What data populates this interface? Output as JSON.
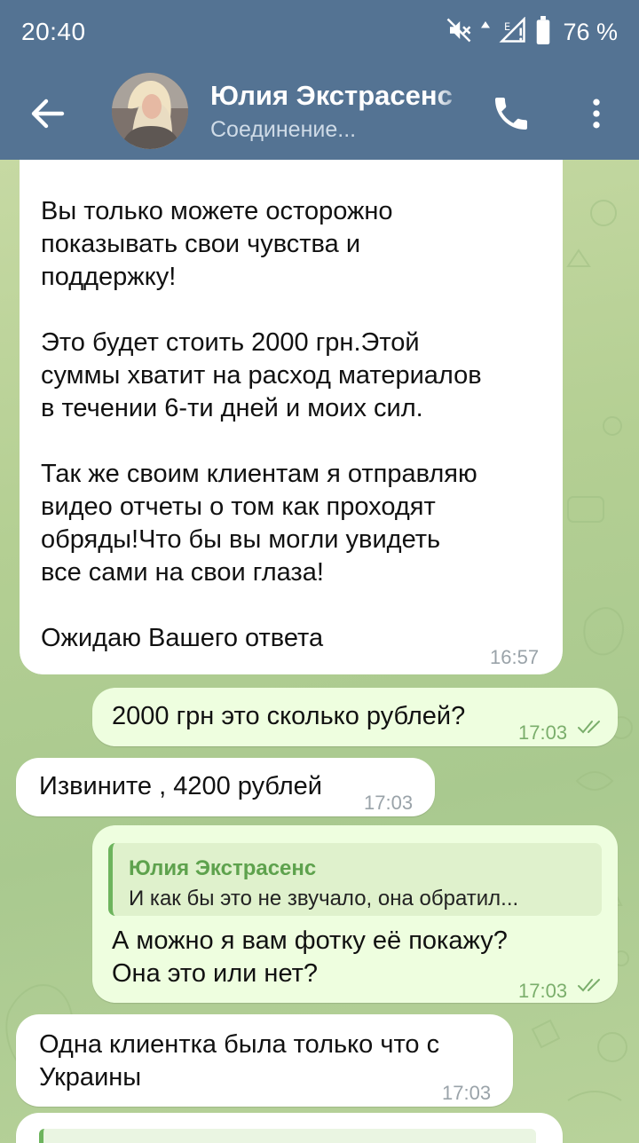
{
  "status_bar": {
    "time": "20:40",
    "battery": "76 %",
    "icons": [
      "mute-icon",
      "data-arrow-icon",
      "signal-e-icon",
      "battery-icon"
    ]
  },
  "app_bar": {
    "contact_name": "Юлия Экстрасенс",
    "contact_status": "Соединение...",
    "icons": [
      "back-arrow-icon",
      "avatar",
      "phone-icon",
      "more-vert-icon"
    ],
    "bar_color": "#547393"
  },
  "messages": [
    {
      "direction": "in",
      "text": "Вы только можете осторожно\nпоказывать свои чувства и\nподдержку!\n\nЭто будет стоить 2000 грн.Этой\nсуммы хватит на расход материалов\nв течении 6-ти дней и моих сил.\n\nТак же своим клиентам я отправляю\nвидео отчеты о том как проходят\nобряды!Что бы вы могли увидеть\nвсе сами на свои глаза!\n\nОжидаю Вашего ответа",
      "time": "16:57"
    },
    {
      "direction": "out",
      "text": "2000 грн это сколько рублей?",
      "time": "17:03",
      "read": true
    },
    {
      "direction": "in",
      "text": "Извините , 4200 рублей",
      "time": "17:03"
    },
    {
      "direction": "out",
      "reply_author": "Юлия Экстрасенс",
      "reply_text": "И как бы это не звучало, она  обратил...",
      "text": "А можно я вам фотку её покажу?\nОна это или нет?",
      "time": "17:03",
      "read": true
    },
    {
      "direction": "in",
      "text": "Одна клиентка была только что с\nУкраины",
      "time": "17:03"
    }
  ],
  "colors": {
    "incoming_bubble": "#ffffff",
    "outgoing_bubble": "#eefedf",
    "accent_green": "#5ea24d"
  }
}
